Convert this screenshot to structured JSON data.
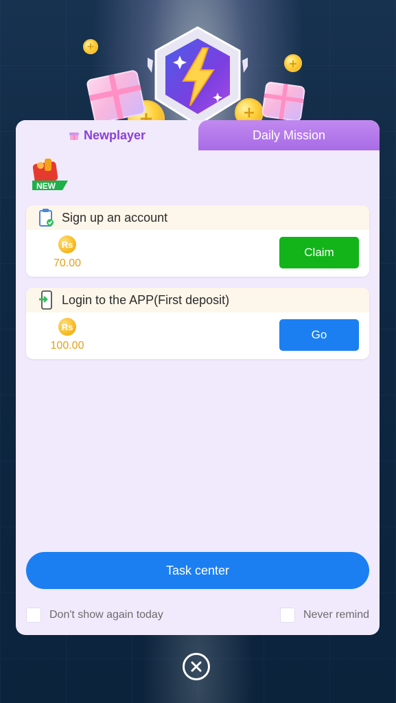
{
  "tabs": {
    "newplayer": "Newplayer",
    "daily_mission": "Daily Mission"
  },
  "new_badge": {
    "label": "NEW"
  },
  "tasks": [
    {
      "title": "Sign up an account",
      "currency": "Rs",
      "amount": "70.00",
      "action": "Claim",
      "action_color": "#12b41a",
      "icon": "clipboard-check-icon"
    },
    {
      "title": "Login to the APP(First deposit)",
      "currency": "Rs",
      "amount": "100.00",
      "action": "Go",
      "action_color": "#1b7ff2",
      "icon": "phone-login-icon"
    }
  ],
  "task_center": {
    "label": "Task center"
  },
  "options": {
    "dont_show": "Don't show again today",
    "never_remind": "Never remind"
  },
  "colors": {
    "accent_purple": "#8a3fd6",
    "tab_inactive": "#a86be6",
    "card_bg": "#f1eafc",
    "reward_gold": "#e3a116",
    "primary_blue": "#1b7ff2",
    "success_green": "#12b41a"
  }
}
